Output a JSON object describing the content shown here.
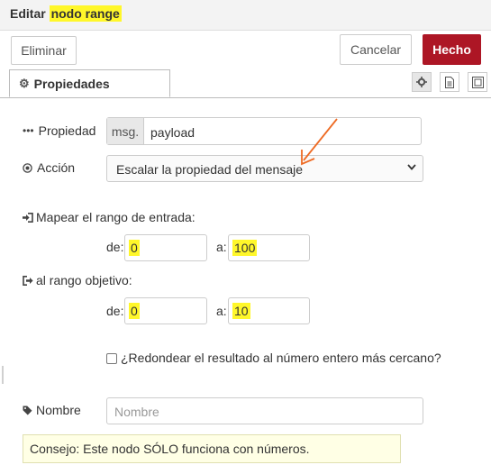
{
  "header": {
    "title_prefix": "Editar ",
    "title_node": "nodo range"
  },
  "toolbar": {
    "delete_label": "Eliminar",
    "cancel_label": "Cancelar",
    "done_label": "Hecho"
  },
  "tabs": {
    "properties_label": "Propiedades"
  },
  "form": {
    "property_label": "Propiedad",
    "property_prefix": "msg.",
    "property_value": "payload",
    "action_label": "Acción",
    "action_value": "Escalar la propiedad del mensaje",
    "input_range_label": "Mapear el rango de entrada:",
    "target_range_label": "al rango objetivo:",
    "from_label": "de:",
    "to_label": "a:",
    "input_from": "0",
    "input_to": "100",
    "target_from": "0",
    "target_to": "10",
    "round_label": "¿Redondear el resultado al número entero más cercano?",
    "name_label": "Nombre",
    "name_placeholder": "Nombre",
    "tip": "Consejo: Este nodo SÓLO funciona con números."
  },
  "colors": {
    "highlight": "#fff72a",
    "done_button": "#ad1625",
    "annotation_arrow": "#ee6b24"
  }
}
